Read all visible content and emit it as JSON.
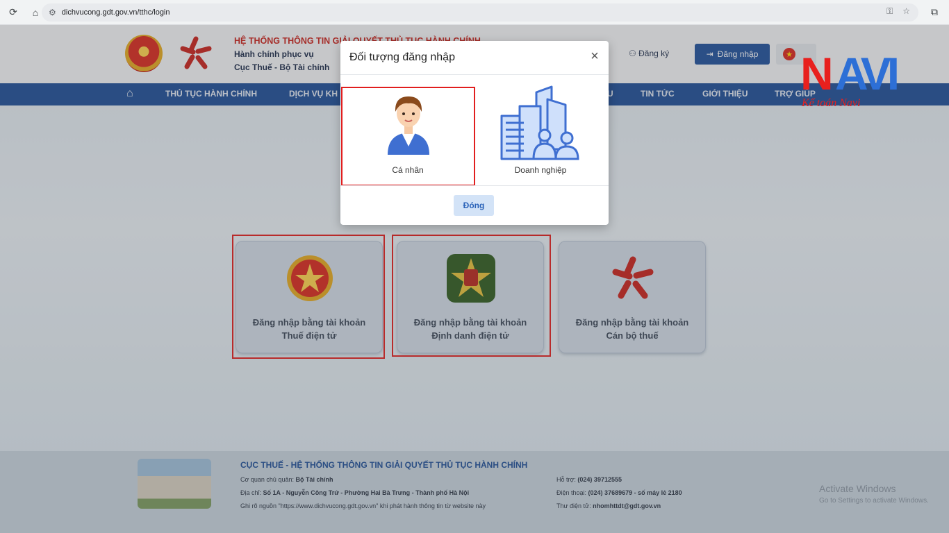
{
  "browser": {
    "url": "dichvucong.gdt.gov.vn/tthc/login"
  },
  "header": {
    "title": "HỆ THỐNG THÔNG TIN GIẢI QUYẾT THỦ TỤC HÀNH CHÍNH",
    "subtitle1": "Hành chính phục vụ",
    "subtitle2": "Cục Thuế - Bộ Tài chính",
    "register_label": "Đăng ký",
    "login_label": "Đăng nhập"
  },
  "navbar": {
    "items": [
      "THỦ TỤC HÀNH CHÍNH",
      "DỊCH VỤ KH",
      "U",
      "TIN TỨC",
      "GIỚI THIỆU",
      "TRỢ GIÚP"
    ]
  },
  "login_cards": [
    {
      "label_line1": "Đăng nhập bằng tài khoản",
      "label_line2": "Thuế điện tử",
      "highlighted": true
    },
    {
      "label_line1": "Đăng nhập bằng tài khoản",
      "label_line2": "Định danh điện tử",
      "highlighted": true
    },
    {
      "label_line1": "Đăng nhập bằng tài khoản",
      "label_line2": "Cán bộ thuế",
      "highlighted": false
    }
  ],
  "modal": {
    "title": "Đối tượng đăng nhập",
    "options": [
      {
        "label": "Cá nhân",
        "highlighted": true
      },
      {
        "label": "Doanh nghiệp",
        "highlighted": false
      }
    ],
    "close_label": "Đóng"
  },
  "footer": {
    "title": "CỤC THUẾ - HỆ THỐNG THÔNG TIN GIẢI QUYẾT THỦ TỤC HÀNH CHÍNH",
    "agency_label": "Cơ quan chủ quản:",
    "agency_value": "Bộ Tài chính",
    "address_label": "Địa chỉ:",
    "address_value": "Số 1A - Nguyễn Công Trứ - Phường Hai Bà Trưng - Thành phố Hà Nội",
    "source_note": "Ghi rõ nguồn \"https://www.dichvucong.gdt.gov.vn\" khi phát hành thông tin từ website này",
    "support_label": "Hỗ trợ:",
    "support_value": "(024) 39712555",
    "phone_label": "Điện thoại:",
    "phone_value": "(024) 37689679 - số máy lẻ 2180",
    "email_label": "Thư điện tử:",
    "email_value": "nhomhttdt@gdt.gov.vn"
  },
  "windows_notice": {
    "line1": "Activate Windows",
    "line2": "Go to Settings to activate Windows."
  },
  "watermark": {
    "brand_n": "N",
    "brand_rest": "AVI",
    "tagline": "Kế toán Navi"
  },
  "colors": {
    "nav_blue": "#1c4d97",
    "accent_red": "#c8201b",
    "highlight_red": "#e11e1e"
  }
}
